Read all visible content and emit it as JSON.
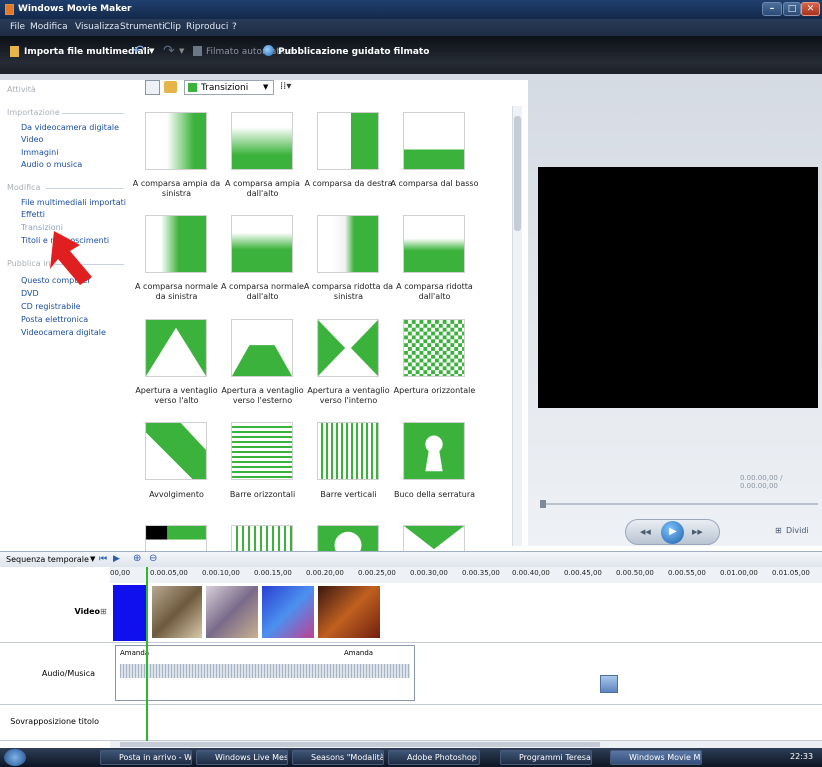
{
  "window": {
    "title": "Windows Movie Maker"
  },
  "menu": [
    "File",
    "Modifica",
    "Visualizza",
    "Strumenti",
    "Clip",
    "Riproduci",
    "?"
  ],
  "toolbar": {
    "import": "Importa file multimediali",
    "auto_movie": "Filmato automatico",
    "publish": "Pubblicazione guidato filmato"
  },
  "tasks": {
    "title": "Attività",
    "import_header": "Importazione",
    "import_items": [
      "Da videocamera digitale",
      "Video",
      "Immagini",
      "Audio o musica"
    ],
    "edit_header": "Modifica",
    "edit_items": [
      "File multimediali importati",
      "Effetti",
      "Transizioni",
      "Titoli e riconoscimenti"
    ],
    "publish_header": "Pubblica in",
    "publish_items": [
      "Questo computer",
      "DVD",
      "CD registrabile",
      "Posta elettronica",
      "Videocamera digitale"
    ]
  },
  "collection": {
    "dropdown": "Transizioni"
  },
  "transitions": [
    "A comparsa ampia da sinistra",
    "A comparsa ampia dall'alto",
    "A comparsa da destra",
    "A comparsa dal basso",
    "A comparsa normale da sinistra",
    "A comparsa normale dall'alto",
    "A comparsa ridotta da sinistra",
    "A comparsa ridotta dall'alto",
    "Apertura a ventaglio verso l'alto",
    "Apertura a ventaglio verso l'esterno",
    "Apertura a ventaglio verso l'interno",
    "Apertura orizzontale",
    "Avvolgimento",
    "Barre orizzontali",
    "Barre verticali",
    "Buco della serratura"
  ],
  "preview": {
    "time": "0.00.00,00 / 0.00.00,00",
    "split": "Dividi"
  },
  "timeline": {
    "mode": "Sequenza temporale",
    "ticks": [
      "00,00",
      "0.00.05,00",
      "0.00.10,00",
      "0.00.15,00",
      "0.00.20,00",
      "0.00.25,00",
      "0.00.30,00",
      "0.00.35,00",
      "0.00.40,00",
      "0.00.45,00",
      "0.00.50,00",
      "0.00.55,00",
      "0.01.00,00",
      "0.01.05,00"
    ],
    "video_label": "Video",
    "audio_label": "Audio/Musica",
    "title_overlay_label": "Sovrapposizione titolo",
    "audio_clip_1": "Amanda",
    "audio_clip_2": "Amanda"
  },
  "taskbar": [
    "Posta in arrivo - Win...",
    "Windows Live Mess...",
    "Seasons \"Modalità d...",
    "Adobe Photoshop",
    "Programmi Teresa",
    "Windows Movie Ma..."
  ],
  "clock": "22:33",
  "colors": {
    "accent_green": "#3bb23b",
    "link_blue": "#1b4ea0",
    "pointer_red": "#e02020"
  }
}
